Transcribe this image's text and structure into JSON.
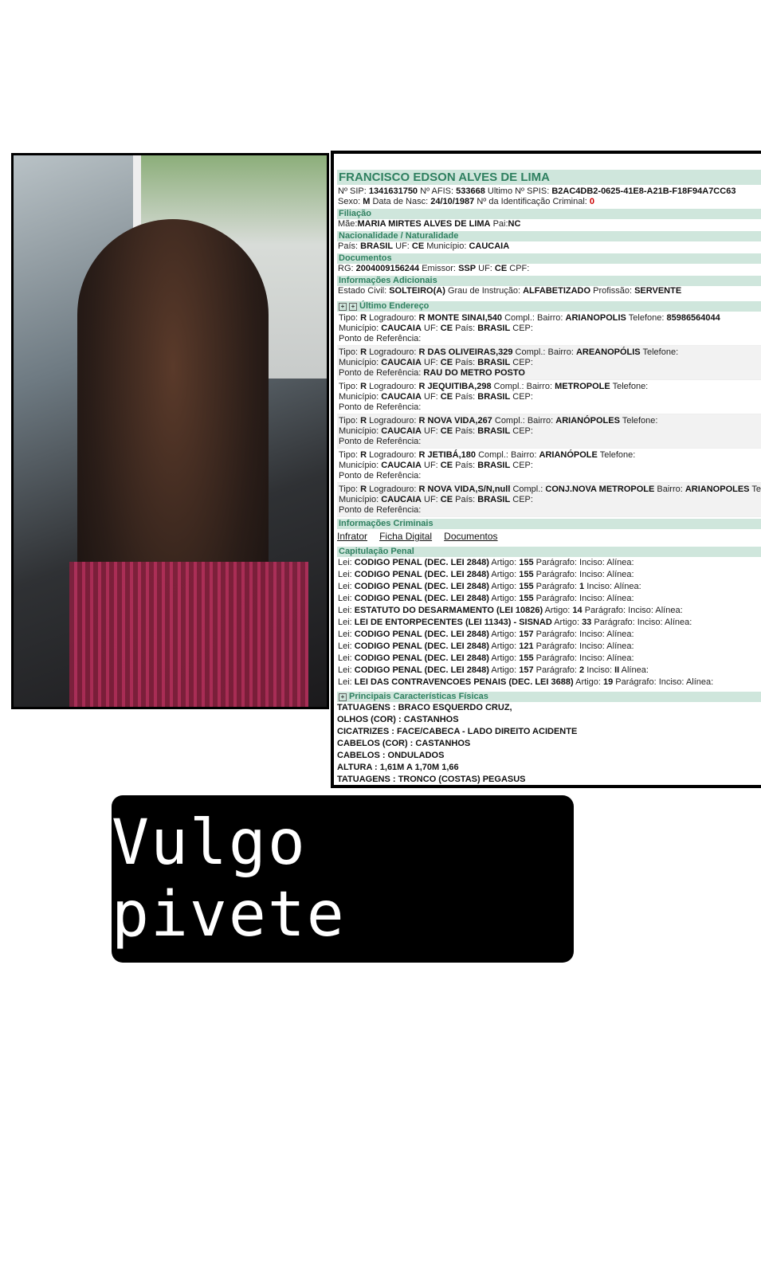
{
  "person": {
    "name": "FRANCISCO EDSON ALVES DE LIMA",
    "sip": "1341631750",
    "afis": "533668",
    "spis": "B2AC4DB2-0625-41E8-A21B-F18F94A7CC63",
    "sexo": "M",
    "nasc": "24/10/1987",
    "ident_criminal": "0"
  },
  "labels": {
    "sip": "Nº SIP:",
    "afis": "Nº AFIS:",
    "spis": "Ultimo Nº SPIS:",
    "sexo": "Sexo:",
    "nasc": "Data de Nasc:",
    "ident": "Nº da Identificação Criminal:"
  },
  "filiacao": {
    "title": "Filiação",
    "mae_label": "Mãe:",
    "mae": "MARIA MIRTES ALVES DE LIMA",
    "pai_label": "Pai:",
    "pai": "NC"
  },
  "nacionalidade": {
    "title": "Nacionalidade / Naturalidade",
    "pais": "BRASIL",
    "uf": "CE",
    "municipio": "CAUCAIA"
  },
  "documentos": {
    "title": "Documentos",
    "rg": "2004009156244",
    "emissor": "SSP",
    "uf": "CE",
    "cpf": ""
  },
  "info_adicionais": {
    "title": "Informações Adicionais",
    "estado_civil": "SOLTEIRO(A)",
    "instrucao": "ALFABETIZADO",
    "profissao": "SERVENTE"
  },
  "endereco": {
    "title": "Último Endereço",
    "items": [
      {
        "logradouro": "R MONTE SINAI,540",
        "bairro": "ARIANOPOLIS",
        "telefone": "85986564044",
        "referencia": ""
      },
      {
        "logradouro": "R DAS OLIVEIRAS,329",
        "bairro": "AREANOPÓLIS",
        "telefone": "",
        "referencia": "RAU DO METRO POSTO"
      },
      {
        "logradouro": "R JEQUITIBA,298",
        "bairro": "METROPOLE",
        "telefone": "",
        "referencia": ""
      },
      {
        "logradouro": "R NOVA VIDA,267",
        "bairro": "ARIANÓPOLES",
        "telefone": "",
        "referencia": ""
      },
      {
        "logradouro": "R JETIBÁ,180",
        "bairro": "ARIANÓPOLE",
        "telefone": "",
        "referencia": ""
      },
      {
        "logradouro": "R NOVA VIDA,S/N,null",
        "compl": "CONJ.NOVA METROPOLE",
        "bairro": "ARIANOPOLES",
        "telefone": "",
        "referencia": ""
      }
    ]
  },
  "info_criminais": {
    "title": "Informações Criminais",
    "links": [
      "Infrator",
      "Ficha Digital",
      "Documentos"
    ]
  },
  "capitulacao": {
    "title": "Capitulação Penal",
    "items": [
      {
        "lei": "CODIGO PENAL (DEC. LEI 2848)",
        "artigo": "155",
        "paragrafo": "",
        "inciso": ""
      },
      {
        "lei": "CODIGO PENAL (DEC. LEI 2848)",
        "artigo": "155",
        "paragrafo": "",
        "inciso": ""
      },
      {
        "lei": "CODIGO PENAL (DEC. LEI 2848)",
        "artigo": "155",
        "paragrafo": "1",
        "inciso": ""
      },
      {
        "lei": "CODIGO PENAL (DEC. LEI 2848)",
        "artigo": "155",
        "paragrafo": "",
        "inciso": ""
      },
      {
        "lei": "ESTATUTO DO DESARMAMENTO (LEI 10826)",
        "artigo": "14",
        "paragrafo": "",
        "inciso": ""
      },
      {
        "lei": "LEI DE ENTORPECENTES (LEI 11343) - SISNAD",
        "artigo": "33",
        "paragrafo": "",
        "inciso": ""
      },
      {
        "lei": "CODIGO PENAL (DEC. LEI 2848)",
        "artigo": "157",
        "paragrafo": "",
        "inciso": ""
      },
      {
        "lei": "CODIGO PENAL (DEC. LEI 2848)",
        "artigo": "121",
        "paragrafo": "",
        "inciso": ""
      },
      {
        "lei": "CODIGO PENAL (DEC. LEI 2848)",
        "artigo": "155",
        "paragrafo": "",
        "inciso": ""
      },
      {
        "lei": "CODIGO PENAL (DEC. LEI 2848)",
        "artigo": "157",
        "paragrafo": "2",
        "inciso": "II"
      },
      {
        "lei": "LEI DAS CONTRAVENCOES PENAIS (DEC. LEI 3688)",
        "artigo": "19",
        "paragrafo": "",
        "inciso": ""
      }
    ]
  },
  "caracteristicas": {
    "title": "Principais Características Físicas",
    "items": [
      "TATUAGENS : BRACO ESQUERDO CRUZ,",
      "OLHOS (COR) : CASTANHOS",
      "CICATRIZES : FACE/CABECA - LADO DIREITO ACIDENTE",
      "CABELOS (COR) : CASTANHOS",
      "CABELOS : ONDULADOS",
      "ALTURA : 1,61M A 1,70M 1,66",
      "TATUAGENS : TRONCO (COSTAS) PEGASUS"
    ]
  },
  "banner": {
    "text": "Vulgo pivete"
  }
}
